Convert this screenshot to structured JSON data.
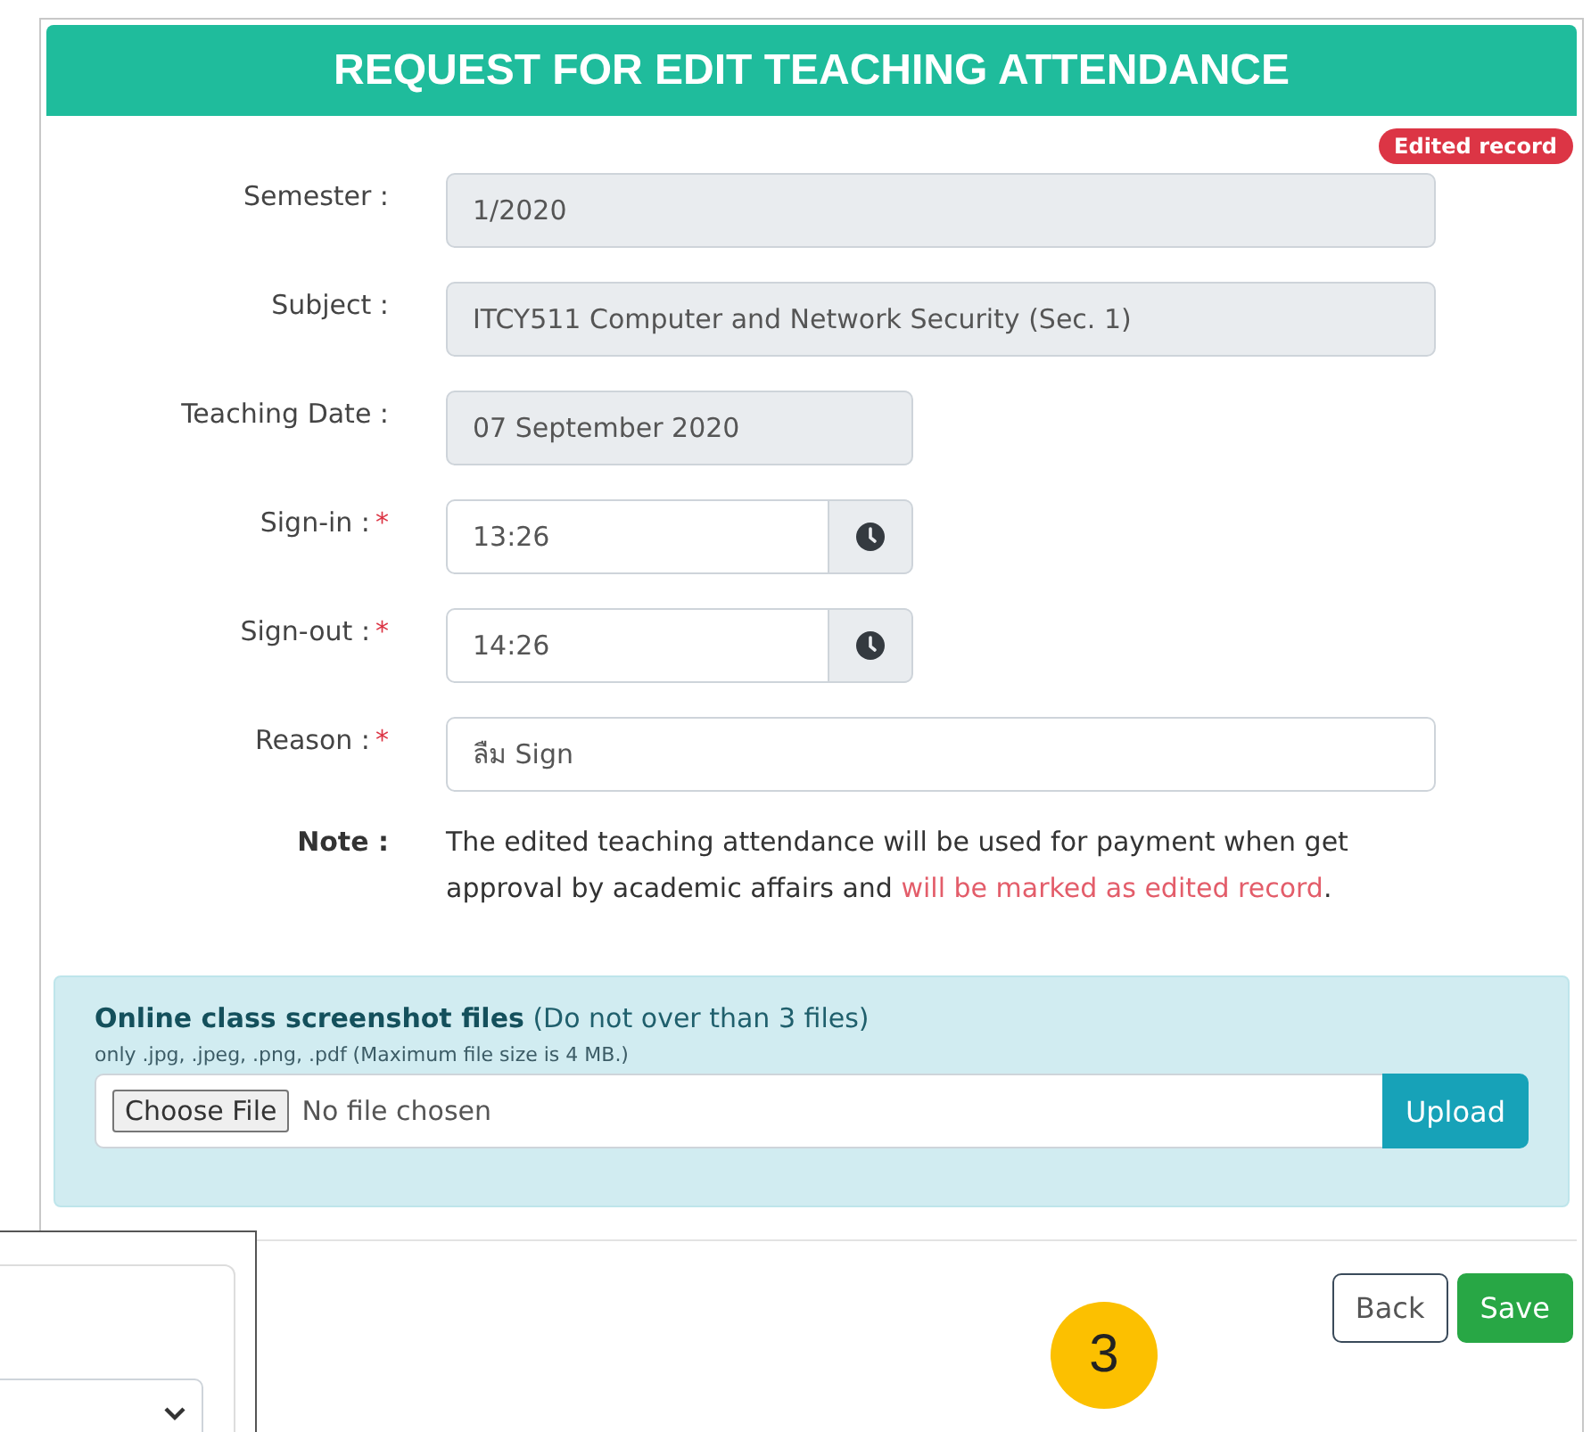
{
  "header": {
    "title": "REQUEST FOR EDIT TEACHING ATTENDANCE"
  },
  "badge": "Edited record",
  "fields": [
    {
      "kind": "readonly",
      "label": "Semester :",
      "value": "1/2020"
    },
    {
      "kind": "readonly",
      "label": "Subject :",
      "value": "ITCY511 Computer and Network Security (Sec. 1)"
    },
    {
      "kind": "date",
      "label": "Teaching Date :",
      "value": "07 September 2020"
    },
    {
      "kind": "time",
      "label": "Sign-in :",
      "required_mark": "*",
      "value": "13:26"
    },
    {
      "kind": "time",
      "label": "Sign-out :",
      "required_mark": "*",
      "value": "14:26"
    },
    {
      "kind": "text",
      "label": "Reason :",
      "required_mark": "*",
      "value": "ลืม Sign"
    }
  ],
  "note": {
    "label": "Note :",
    "text": "The edited teaching attendance will be used for payment when get approval by academic affairs and ",
    "highlight": "will be marked as edited record",
    "end": "."
  },
  "upload": {
    "title": "**Online class screenshot files** (Do not over than 3 files)",
    "hint": "only .jpg, .jpeg, .png, .pdf (Maximum file size is 4 MB.)",
    "choose_button": "Choose File",
    "file_status": "No file chosen",
    "upload_button": "Upload"
  },
  "buttons": {
    "back": "Back",
    "save": "Save"
  },
  "step_badge": "3"
}
